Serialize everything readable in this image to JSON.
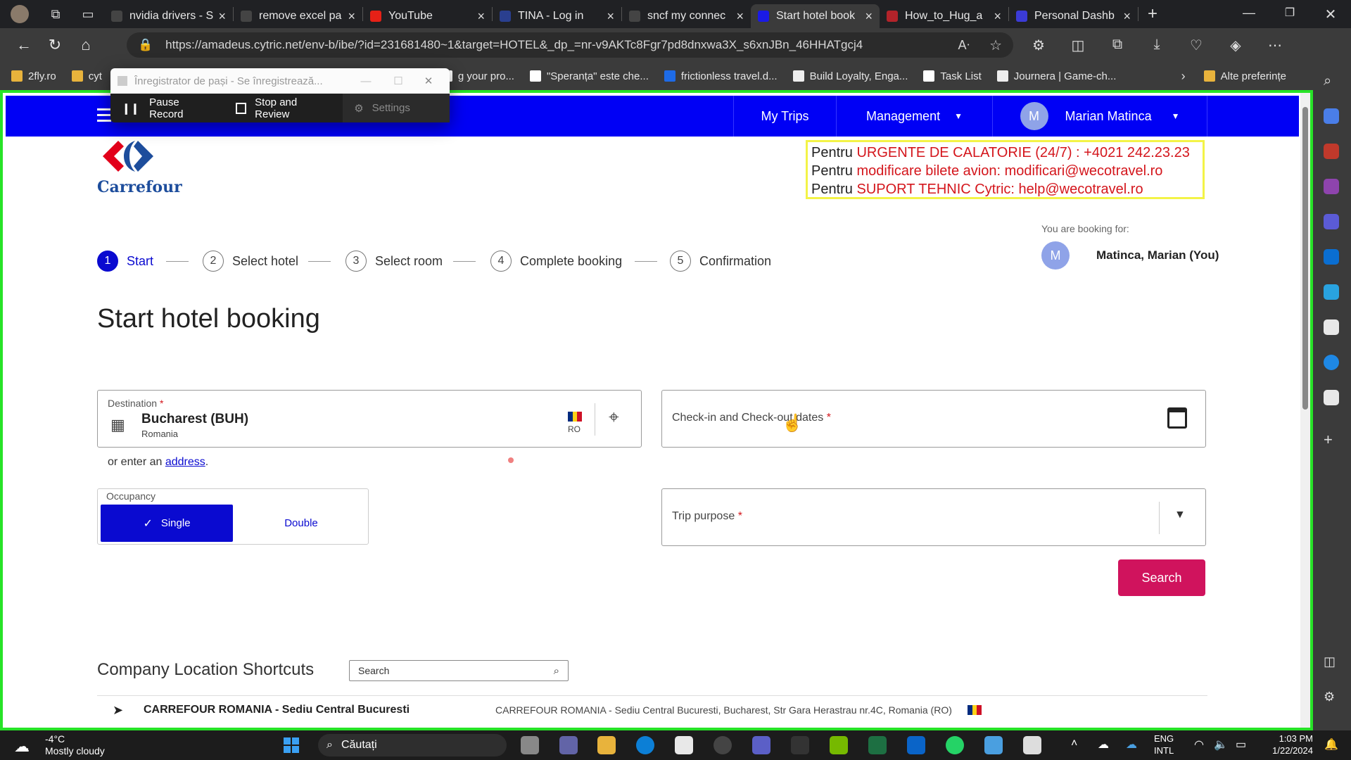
{
  "browser": {
    "tabs": [
      {
        "title": "nvidia drivers - S",
        "color": "#444"
      },
      {
        "title": "remove excel pa",
        "color": "#444"
      },
      {
        "title": "YouTube",
        "color": "#e62117"
      },
      {
        "title": "TINA - Log in",
        "color": "#2a3f8f"
      },
      {
        "title": "sncf my connec",
        "color": "#444"
      },
      {
        "title": "Start hotel book",
        "color": "#1a1ae6"
      },
      {
        "title": "How_to_Hug_a",
        "color": "#b3232a"
      },
      {
        "title": "Personal Dashb",
        "color": "#3b3bd6"
      }
    ],
    "url": "https://amadeus.cytric.net/env-b/ibe/?id=231681480~1&target=HOTEL&_dp_=nr-v9AKTc8Fgr7pd8dnxwa3X_s6xnJBn_46HHATgcj4",
    "favorites": [
      {
        "label": "2fly.ro",
        "folder": true
      },
      {
        "label": "cyt",
        "folder": true
      },
      {
        "label": "g your pro...",
        "folder": false
      },
      {
        "label": "\"Speranța\" este che...",
        "folder": false
      },
      {
        "label": "frictionless travel.d...",
        "folder": false
      },
      {
        "label": "Build Loyalty, Enga...",
        "folder": false
      },
      {
        "label": "Task List",
        "folder": false
      },
      {
        "label": "Journera | Game-ch...",
        "folder": false
      }
    ],
    "other_favorites": "Alte preferințe"
  },
  "recorder": {
    "title": "Înregistrator de pași - Se înregistrează...",
    "pause": "Pause Record",
    "stop": "Stop and Review",
    "settings": "Settings"
  },
  "header": {
    "my_trips": "My Trips",
    "management": "Management",
    "user_initial": "M",
    "user_name": "Marian Matinca"
  },
  "logo": {
    "name": "Carrefour"
  },
  "notice": {
    "l1_prefix": "Pentru ",
    "l1_red": "URGENTE DE CALATORIE (24/7) : +4021 242.23.23",
    "l2_prefix": "Pentru ",
    "l2_red": "modificare bilete avion:  modificari@wecotravel.ro",
    "l3_prefix": "Pentru ",
    "l3_red": "SUPORT TEHNIC Cytric:  help@wecotravel.ro"
  },
  "booking_for": {
    "label": "You are booking for:",
    "initial": "M",
    "name": "Matinca, Marian (You)"
  },
  "steps": [
    {
      "num": "1",
      "label": "Start"
    },
    {
      "num": "2",
      "label": "Select hotel"
    },
    {
      "num": "3",
      "label": "Select room"
    },
    {
      "num": "4",
      "label": "Complete booking"
    },
    {
      "num": "5",
      "label": "Confirmation"
    }
  ],
  "page_title": "Start hotel booking",
  "form": {
    "destination_label": "Destination",
    "required_mark": "*",
    "destination_value": "Bucharest (BUH)",
    "destination_country": "Romania",
    "country_code": "RO",
    "or_enter": "or enter an",
    "address_link": "address",
    "period": ".",
    "dates_placeholder": "Check-in and Check-out dates",
    "occupancy_label": "Occupancy",
    "single": "Single",
    "double": "Double",
    "trip_purpose": "Trip purpose",
    "search": "Search"
  },
  "shortcuts": {
    "title": "Company Location Shortcuts",
    "search_placeholder": "Search",
    "row_name": "CARREFOUR ROMANIA - Sediu Central Bucuresti",
    "row_address": "CARREFOUR ROMANIA - Sediu Central Bucuresti, Bucharest, Str Gara Herastrau nr.4C, Romania (RO)"
  },
  "taskbar": {
    "temp": "-4°C",
    "weather": "Mostly cloudy",
    "search": "Căutați",
    "lang1": "ENG",
    "lang2": "INTL",
    "time": "1:03 PM",
    "date": "1/22/2024"
  }
}
